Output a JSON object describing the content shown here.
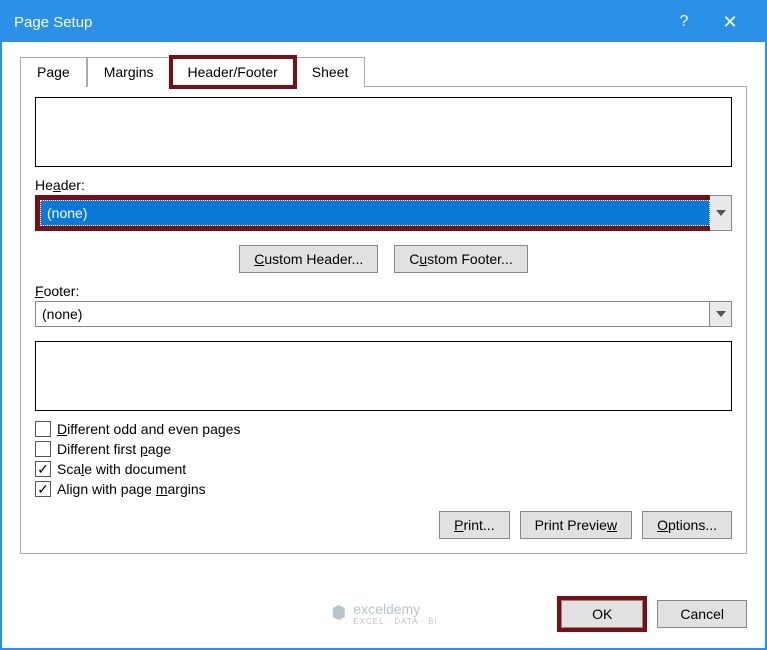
{
  "window": {
    "title": "Page Setup"
  },
  "tabs": {
    "page": "Page",
    "margins": "Margins",
    "headerFooter": "Header/Footer",
    "sheet": "Sheet"
  },
  "labels": {
    "header": "Header:",
    "footer": "Footer:"
  },
  "dropdowns": {
    "header": "(none)",
    "footer": "(none)"
  },
  "buttons": {
    "customHeader": "Custom Header...",
    "customFooter": "Custom Footer...",
    "print": "Print...",
    "printPreview": "Print Preview",
    "options": "Options...",
    "ok": "OK",
    "cancel": "Cancel"
  },
  "checks": {
    "diffOddEven": {
      "label": "Different odd and even pages",
      "checked": false
    },
    "diffFirst": {
      "label": "Different first page",
      "checked": false
    },
    "scaleDoc": {
      "label": "Scale with document",
      "checked": true
    },
    "alignMargins": {
      "label": "Align with page margins",
      "checked": true
    }
  },
  "watermark": {
    "brand": "exceldemy",
    "tagline": "EXCEL · DATA · BI"
  }
}
